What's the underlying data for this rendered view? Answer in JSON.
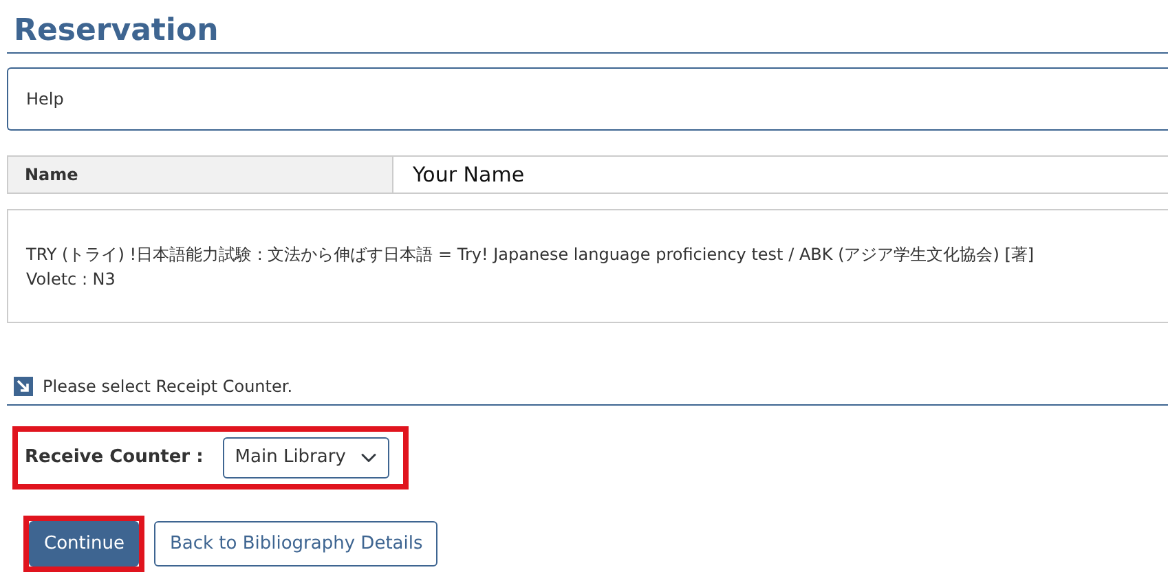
{
  "title": "Reservation",
  "help": {
    "label": "Help"
  },
  "name_row": {
    "label": "Name",
    "value": "Your Name"
  },
  "bibliography": {
    "lines": [
      "TRY (トライ) !日本語能力試験 : 文法から伸ばす日本語 = Try! Japanese language proficiency test / ABK (アジア学生文化協会) [著]",
      "Voletc : N3"
    ]
  },
  "instruction": "Please select Receipt Counter.",
  "counter": {
    "label": "Receive Counter :",
    "value": "Main Library",
    "highlighted": true
  },
  "buttons": [
    {
      "label": "Continue",
      "kind": "primary",
      "highlighted": true
    },
    {
      "label": "Back to Bibliography Details",
      "kind": "secondary",
      "highlighted": false
    }
  ]
}
